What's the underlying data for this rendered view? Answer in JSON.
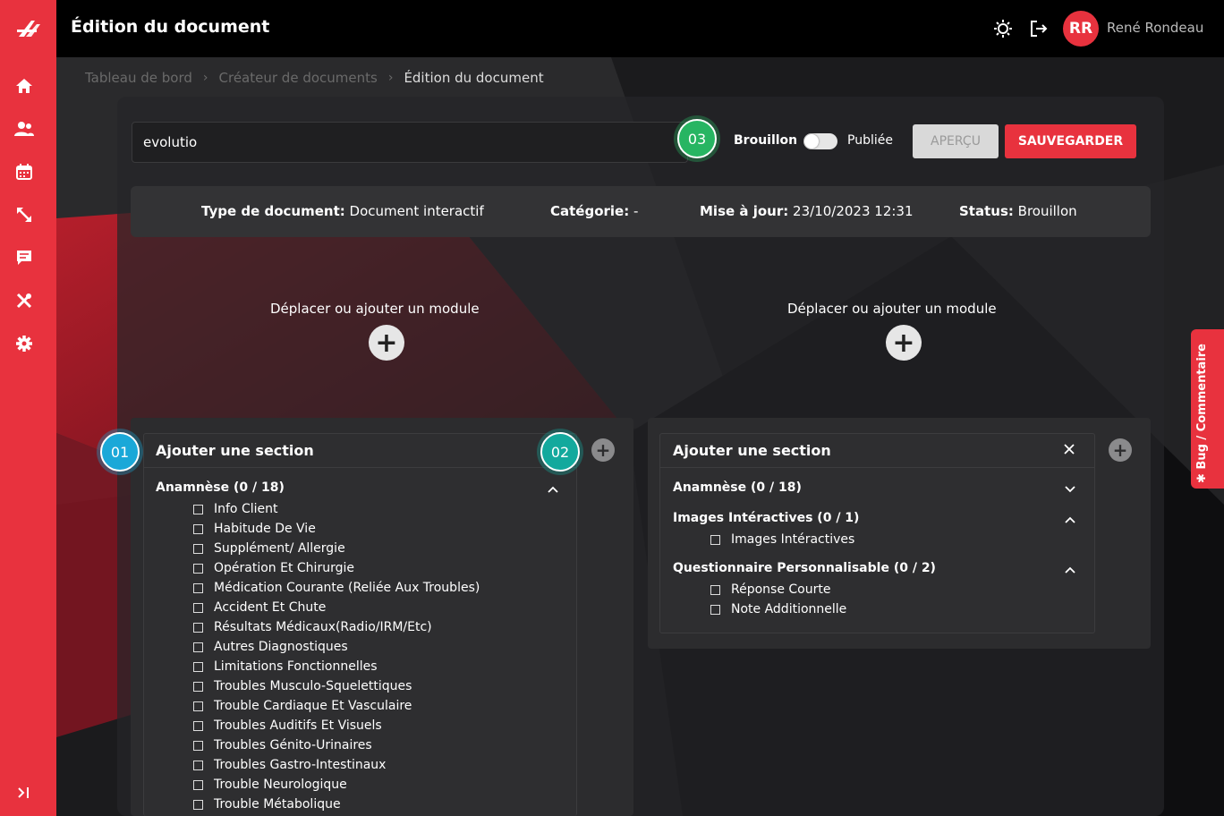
{
  "header": {
    "title": "Édition du document",
    "user_initials": "RR",
    "user_name": "René Rondeau"
  },
  "icons": {
    "logo": "brand-logo-icon",
    "theme": "sun-icon",
    "logout": "logout-icon",
    "sidebar": [
      "home-icon",
      "users-icon",
      "calendar-icon",
      "expand-arrows-icon",
      "message-icon",
      "tools-icon",
      "gear-icon",
      "collapse-sidebar-icon"
    ]
  },
  "breadcrumb": [
    "Tableau de bord",
    "Créateur de documents",
    "Édition du document"
  ],
  "document": {
    "name": "evolutio",
    "status_draft": "Brouillon",
    "status_published": "Publiée",
    "preview_label": "APERÇU",
    "save_label": "SAUVEGARDER"
  },
  "info": {
    "type_label": "Type de document:",
    "type_value": "Document interactif",
    "category_label": "Catégorie:",
    "category_value": "-",
    "updated_label": "Mise à jour:",
    "updated_value": "23/10/2023 12:31",
    "status_label": "Status:",
    "status_value": "Brouillon"
  },
  "modules": {
    "left_label": "Déplacer ou ajouter un module",
    "right_label": "Déplacer ou ajouter un module"
  },
  "badges": [
    "01",
    "02",
    "03"
  ],
  "left_section": {
    "title": "Ajouter une section",
    "group": "Anamnèse (0 / 18)",
    "items": [
      "Info Client",
      "Habitude De Vie",
      "Supplément/ Allergie",
      "Opération Et Chirurgie",
      "Médication Courante (Reliée Aux Troubles)",
      "Accident Et Chute",
      "Résultats Médicaux(Radio/IRM/Etc)",
      "Autres Diagnostiques",
      "Limitations Fonctionnelles",
      "Troubles Musculo-Squelettiques",
      "Trouble Cardiaque Et Vasculaire",
      "Troubles Auditifs Et Visuels",
      "Troubles Génito-Urinaires",
      "Troubles Gastro-Intestinaux",
      "Trouble Neurologique",
      "Trouble Métabolique"
    ]
  },
  "right_section": {
    "title": "Ajouter une section",
    "groups": [
      {
        "title": "Anamnèse (0 / 18)",
        "items": []
      },
      {
        "title": "Images Intéractives (0 / 1)",
        "items": [
          "Images Intéractives"
        ]
      },
      {
        "title": "Questionnaire Personnalisable (0 / 2)",
        "items": [
          "Réponse Courte",
          "Note Additionnelle"
        ]
      }
    ]
  },
  "feedback_tab": "Bug / Commentaire"
}
